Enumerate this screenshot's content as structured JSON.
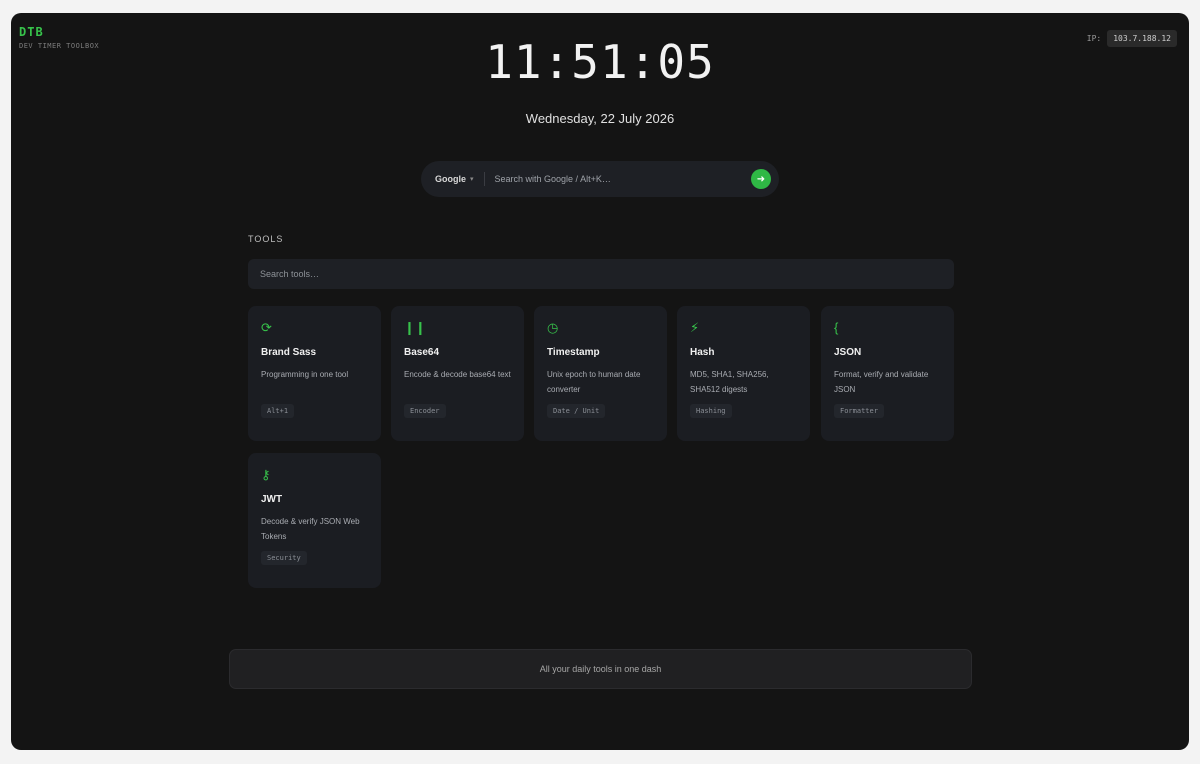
{
  "brand": {
    "name": "DTB",
    "tagline": "DEV TIMER TOOLBOX"
  },
  "ip": {
    "label": "IP:",
    "value": "103.7.188.12"
  },
  "clock": {
    "time": "11:51:05",
    "date": "Wednesday, 22 July 2026"
  },
  "search": {
    "engine": "Google",
    "placeholder": "Search with Google / Alt+K…",
    "go_icon": "arrow-right-icon"
  },
  "tools": {
    "heading": "TOOLS",
    "search_placeholder": "Search tools…",
    "cards": [
      {
        "icon": "refresh-icon",
        "title": "Brand Sass",
        "desc": "Programming in one tool",
        "tag": "Alt+1"
      },
      {
        "icon": "pause-icon",
        "title": "Base64",
        "desc": "Encode & decode base64 text",
        "tag": "Encoder"
      },
      {
        "icon": "clock-icon",
        "title": "Timestamp",
        "desc": "Unix epoch to human date converter",
        "tag": "Date / Unit"
      },
      {
        "icon": "bolt-icon",
        "title": "Hash",
        "desc": "MD5, SHA1, SHA256, SHA512 digests",
        "tag": "Hashing"
      },
      {
        "icon": "braces-icon",
        "title": "JSON",
        "desc": "Format, verify and validate JSON",
        "tag": "Formatter"
      },
      {
        "icon": "key-icon",
        "title": "JWT",
        "desc": "Decode & verify JSON Web Tokens",
        "tag": "Security"
      }
    ]
  },
  "footer": {
    "text": "All your daily tools in one dash"
  },
  "colors": {
    "accent": "#37c24b",
    "background": "#141414",
    "card": "#1b1d22"
  }
}
